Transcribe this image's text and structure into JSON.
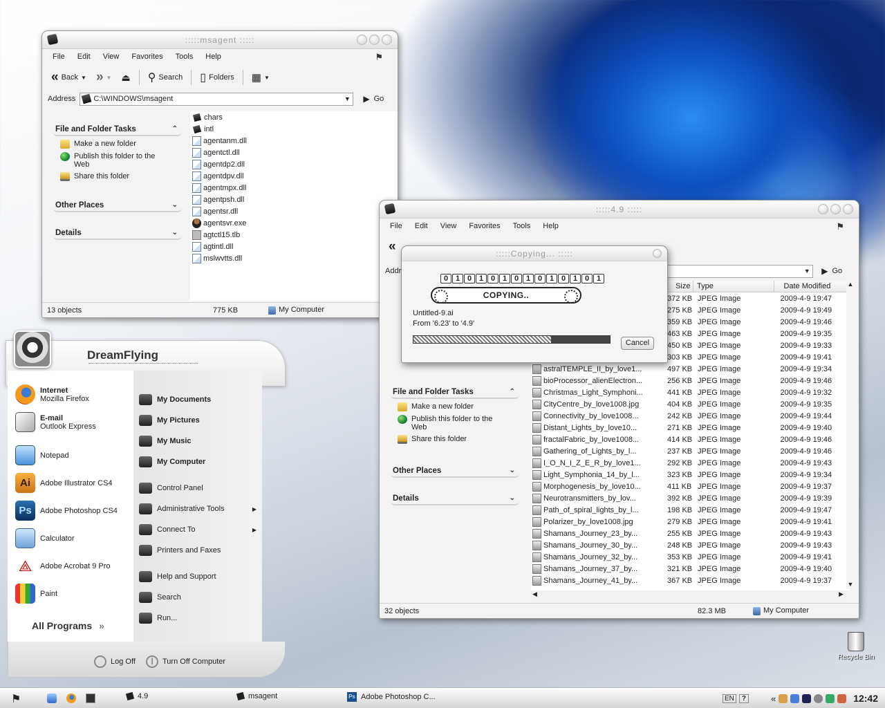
{
  "colors": {
    "accent_blue": "#2a8ef5",
    "desktop_dark": "#0a2c78"
  },
  "win1": {
    "title": ":::::msagent :::::",
    "menu": [
      "File",
      "Edit",
      "View",
      "Favorites",
      "Tools",
      "Help"
    ],
    "toolbar": {
      "back": "Back",
      "search": "Search",
      "folders": "Folders"
    },
    "address": {
      "label": "Address",
      "value": "C:\\WINDOWS\\msagent",
      "go": "Go"
    },
    "tasks": {
      "file_folder": "File and Folder Tasks",
      "make_folder": "Make a new folder",
      "publish": "Publish this folder to the Web",
      "share": "Share this folder",
      "other": "Other Places",
      "details": "Details"
    },
    "files": [
      {
        "name": "chars",
        "kind": "dir"
      },
      {
        "name": "intl",
        "kind": "dir"
      },
      {
        "name": "agentanm.dll",
        "kind": "dll"
      },
      {
        "name": "agentctl.dll",
        "kind": "dll"
      },
      {
        "name": "agentdp2.dll",
        "kind": "dll"
      },
      {
        "name": "agentdpv.dll",
        "kind": "dll"
      },
      {
        "name": "agentmpx.dll",
        "kind": "dll"
      },
      {
        "name": "agentpsh.dll",
        "kind": "dll"
      },
      {
        "name": "agentsr.dll",
        "kind": "dll"
      },
      {
        "name": "agentsvr.exe",
        "kind": "exe"
      },
      {
        "name": "agtctl15.tlb",
        "kind": "tlb"
      },
      {
        "name": "agtintl.dll",
        "kind": "dll"
      },
      {
        "name": "mslwvtts.dll",
        "kind": "dll"
      }
    ],
    "status": {
      "objects": "13 objects",
      "size": "775 KB",
      "location": "My Computer"
    }
  },
  "win2": {
    "title": ":::::4.9 :::::",
    "menu": [
      "File",
      "Edit",
      "View",
      "Favorites",
      "Tools",
      "Help"
    ],
    "address": {
      "label": "Addr",
      "go": "Go"
    },
    "tasks": {
      "file_folder": "File and Folder Tasks",
      "make_folder": "Make a new folder",
      "publish": "Publish this folder to the Web",
      "share": "Share this folder",
      "other": "Other Places",
      "details": "Details"
    },
    "columns": {
      "size": "Size",
      "type": "Type",
      "date": "Date Modified"
    },
    "rows_partial": [
      {
        "size": "372 KB",
        "type": "JPEG Image",
        "date": "2009-4-9 19:47"
      },
      {
        "size": "275 KB",
        "type": "JPEG Image",
        "date": "2009-4-9 19:49"
      },
      {
        "size": "359 KB",
        "type": "JPEG Image",
        "date": "2009-4-9 19:46"
      },
      {
        "size": "463 KB",
        "type": "JPEG Image",
        "date": "2009-4-9 19:35"
      },
      {
        "size": "450 KB",
        "type": "JPEG Image",
        "date": "2009-4-9 19:33"
      },
      {
        "size": "303 KB",
        "type": "JPEG Image",
        "date": "2009-4-9 19:41"
      }
    ],
    "rows": [
      {
        "name": "astralTEMPLE_II_by_love1...",
        "size": "497 KB",
        "type": "JPEG Image",
        "date": "2009-4-9 19:34"
      },
      {
        "name": "bioProcessor_alienElectron...",
        "size": "256 KB",
        "type": "JPEG Image",
        "date": "2009-4-9 19:46"
      },
      {
        "name": "Christmas_Light_Symphoni...",
        "size": "441 KB",
        "type": "JPEG Image",
        "date": "2009-4-9 19:32"
      },
      {
        "name": "CityCentre_by_love1008.jpg",
        "size": "404 KB",
        "type": "JPEG Image",
        "date": "2009-4-9 19:35"
      },
      {
        "name": "Connectivity_by_love1008...",
        "size": "242 KB",
        "type": "JPEG Image",
        "date": "2009-4-9 19:44"
      },
      {
        "name": "Distant_Lights_by_love10...",
        "size": "271 KB",
        "type": "JPEG Image",
        "date": "2009-4-9 19:40"
      },
      {
        "name": "fractalFabric_by_love1008...",
        "size": "414 KB",
        "type": "JPEG Image",
        "date": "2009-4-9 19:46"
      },
      {
        "name": "Gathering_of_Lights_by_l...",
        "size": "237 KB",
        "type": "JPEG Image",
        "date": "2009-4-9 19:46"
      },
      {
        "name": "I_O_N_I_Z_E_R_by_love1...",
        "size": "292 KB",
        "type": "JPEG Image",
        "date": "2009-4-9 19:43"
      },
      {
        "name": "Light_Symphonia_14_by_l...",
        "size": "323 KB",
        "type": "JPEG Image",
        "date": "2009-4-9 19:34"
      },
      {
        "name": "Morphogenesis_by_love10...",
        "size": "411 KB",
        "type": "JPEG Image",
        "date": "2009-4-9 19:37"
      },
      {
        "name": "Neurotransmitters_by_lov...",
        "size": "392 KB",
        "type": "JPEG Image",
        "date": "2009-4-9 19:39"
      },
      {
        "name": "Path_of_spiral_lights_by_l...",
        "size": "198 KB",
        "type": "JPEG Image",
        "date": "2009-4-9 19:47"
      },
      {
        "name": "Polarizer_by_love1008.jpg",
        "size": "279 KB",
        "type": "JPEG Image",
        "date": "2009-4-9 19:41"
      },
      {
        "name": "Shamans_Journey_23_by...",
        "size": "255 KB",
        "type": "JPEG Image",
        "date": "2009-4-9 19:43"
      },
      {
        "name": "Shamans_Journey_30_by...",
        "size": "248 KB",
        "type": "JPEG Image",
        "date": "2009-4-9 19:43"
      },
      {
        "name": "Shamans_Journey_32_by...",
        "size": "353 KB",
        "type": "JPEG Image",
        "date": "2009-4-9 19:41"
      },
      {
        "name": "Shamans_Journey_37_by...",
        "size": "321 KB",
        "type": "JPEG Image",
        "date": "2009-4-9 19:40"
      },
      {
        "name": "Shamans_Journey_41_by...",
        "size": "367 KB",
        "type": "JPEG Image",
        "date": "2009-4-9 19:37"
      }
    ],
    "status": {
      "objects": "32 objects",
      "size": "82.3 MB",
      "location": "My Computer"
    }
  },
  "dialog": {
    "title": ":::::Copying... :::::",
    "binary": [
      "0",
      "1",
      "0",
      "1",
      "0",
      "1",
      "0",
      "1",
      "0",
      "1",
      "0",
      "1",
      "0",
      "1"
    ],
    "banner": "COPYING..",
    "file": "Untitled-9.ai",
    "from": "From '6.23' to '4.9'",
    "progress": 0.7,
    "cancel": "Cancel"
  },
  "start_menu": {
    "user": "DreamFlying",
    "pinned": [
      {
        "title": "Internet",
        "sub": "Mozilla Firefox",
        "icon": "firefox-icon"
      },
      {
        "title": "E-mail",
        "sub": "Outlook Express",
        "icon": "outlook-icon"
      }
    ],
    "recent": [
      {
        "label": "Notepad",
        "icon": "notepad-icon"
      },
      {
        "label": "Adobe Illustrator CS4",
        "icon": "illustrator-icon",
        "glyph": "Ai"
      },
      {
        "label": "Adobe Photoshop CS4",
        "icon": "photoshop-icon",
        "glyph": "Ps"
      },
      {
        "label": "Calculator",
        "icon": "calculator-icon"
      },
      {
        "label": "Adobe Acrobat 9 Pro",
        "icon": "acrobat-icon"
      },
      {
        "label": "Paint",
        "icon": "paint-icon"
      }
    ],
    "all_programs": "All Programs",
    "places": [
      {
        "label": "My Documents",
        "bold": true
      },
      {
        "label": "My Pictures",
        "bold": true
      },
      {
        "label": "My Music",
        "bold": true
      },
      {
        "label": "My Computer",
        "bold": true
      },
      {
        "label": "Control Panel",
        "bold": false
      },
      {
        "label": "Administrative Tools",
        "bold": false,
        "arrow": true
      },
      {
        "label": "Connect To",
        "bold": false,
        "arrow": true
      },
      {
        "label": "Printers and Faxes",
        "bold": false
      },
      {
        "label": "Help and Support",
        "bold": false
      },
      {
        "label": "Search",
        "bold": false
      },
      {
        "label": "Run...",
        "bold": false
      }
    ],
    "log_off": "Log Off",
    "turn_off": "Turn Off Computer"
  },
  "desktop": {
    "recycle_bin": "Recycle Bin"
  },
  "taskbar": {
    "buttons": [
      {
        "label": "4.9"
      },
      {
        "label": "msagent"
      },
      {
        "label": "Adobe Photoshop C..."
      }
    ],
    "lang": "EN",
    "help": "?",
    "clock": "12:42"
  }
}
